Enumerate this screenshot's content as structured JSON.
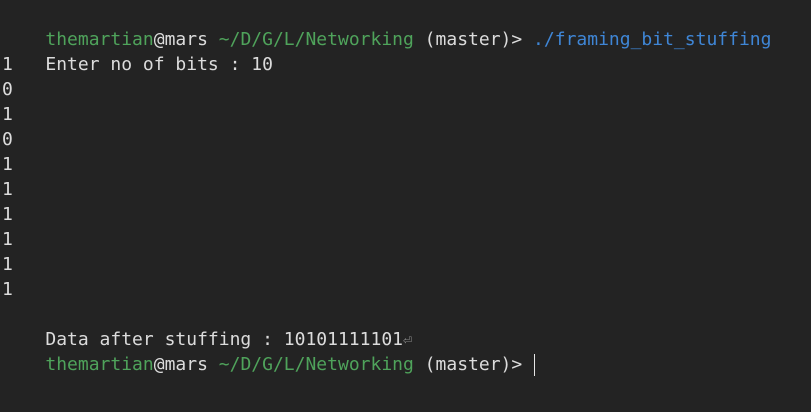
{
  "prompt1": {
    "user": "themartian",
    "at": "@",
    "host": "mars",
    "path": " ~/D/G/L/Networking",
    "branch": " (master)>",
    "command": " ./framing_bit_stuffing"
  },
  "output": {
    "enter_label": "Enter no of bits : ",
    "enter_value": "10",
    "bits": [
      "1",
      "0",
      "1",
      "0",
      "1",
      "1",
      "1",
      "1",
      "1",
      "1"
    ],
    "result_label": "Data after stuffing : ",
    "result_value": "10101111101",
    "return_glyph": "⏎"
  },
  "prompt2": {
    "user": "themartian",
    "at": "@",
    "host": "mars",
    "path": " ~/D/G/L/Networking",
    "branch": " (master)>",
    "command": " "
  },
  "colors": {
    "background": "#232323",
    "text": "#dcdcdc",
    "prompt_green": "#4fa35b",
    "command_blue": "#3f86d6"
  }
}
